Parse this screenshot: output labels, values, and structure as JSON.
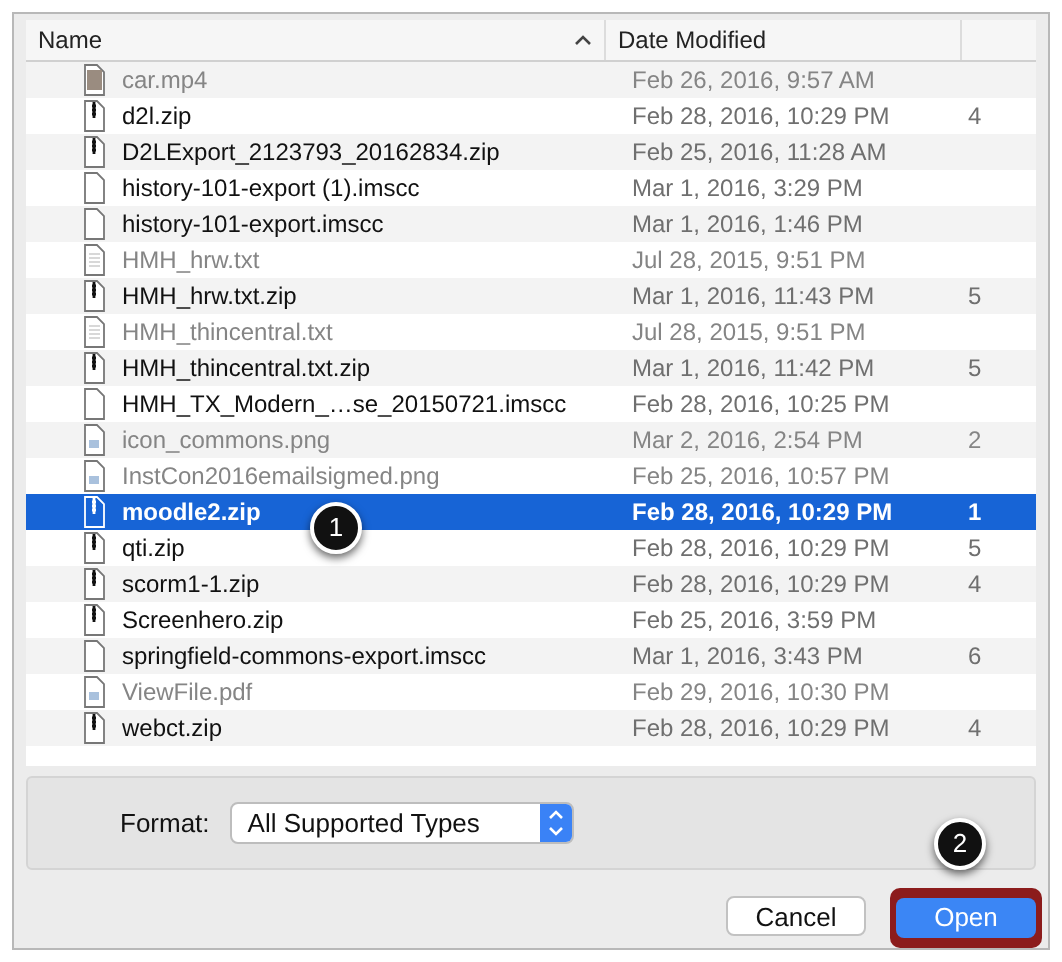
{
  "columns": [
    {
      "label": "Name",
      "sorted": true
    },
    {
      "label": "Date Modified",
      "sorted": false
    }
  ],
  "files": [
    {
      "name": "car.mp4",
      "date": "Feb 26, 2016, 9:57 AM",
      "kind": "video",
      "disabled": true,
      "selected": false
    },
    {
      "name": "d2l.zip",
      "date": "Feb 28, 2016, 10:29 PM",
      "size": "4",
      "kind": "zip",
      "disabled": false,
      "selected": false
    },
    {
      "name": "D2LExport_2123793_20162834.zip",
      "date": "Feb 25, 2016, 11:28 AM",
      "kind": "zip",
      "disabled": false,
      "selected": false
    },
    {
      "name": "history-101-export (1).imscc",
      "date": "Mar 1, 2016, 3:29 PM",
      "kind": "doc",
      "disabled": false,
      "selected": false
    },
    {
      "name": "history-101-export.imscc",
      "date": "Mar 1, 2016, 1:46 PM",
      "kind": "doc",
      "disabled": false,
      "selected": false
    },
    {
      "name": "HMH_hrw.txt",
      "date": "Jul 28, 2015, 9:51 PM",
      "kind": "text",
      "disabled": true,
      "selected": false
    },
    {
      "name": "HMH_hrw.txt.zip",
      "date": "Mar 1, 2016, 11:43 PM",
      "size": "5",
      "kind": "zip",
      "disabled": false,
      "selected": false
    },
    {
      "name": "HMH_thincentral.txt",
      "date": "Jul 28, 2015, 9:51 PM",
      "kind": "text",
      "disabled": true,
      "selected": false
    },
    {
      "name": "HMH_thincentral.txt.zip",
      "date": "Mar 1, 2016, 11:42 PM",
      "size": "5",
      "kind": "zip",
      "disabled": false,
      "selected": false
    },
    {
      "name": "HMH_TX_Modern_…se_20150721.imscc",
      "date": "Feb 28, 2016, 10:25 PM",
      "kind": "doc",
      "disabled": false,
      "selected": false
    },
    {
      "name": "icon_commons.png",
      "date": "Mar 2, 2016, 2:54 PM",
      "size": "2",
      "kind": "image",
      "disabled": true,
      "selected": false
    },
    {
      "name": "InstCon2016emailsigmed.png",
      "date": "Feb 25, 2016, 10:57 PM",
      "kind": "image",
      "disabled": true,
      "selected": false
    },
    {
      "name": "moodle2.zip",
      "date": "Feb 28, 2016, 10:29 PM",
      "size": "1",
      "kind": "zip",
      "disabled": false,
      "selected": true
    },
    {
      "name": "qti.zip",
      "date": "Feb 28, 2016, 10:29 PM",
      "size": "5",
      "kind": "zip",
      "disabled": false,
      "selected": false
    },
    {
      "name": "scorm1-1.zip",
      "date": "Feb 28, 2016, 10:29 PM",
      "size": "4",
      "kind": "zip",
      "disabled": false,
      "selected": false
    },
    {
      "name": "Screenhero.zip",
      "date": "Feb 25, 2016, 3:59 PM",
      "kind": "zip",
      "disabled": false,
      "selected": false
    },
    {
      "name": "springfield-commons-export.imscc",
      "date": "Mar 1, 2016, 3:43 PM",
      "size": "6",
      "kind": "doc",
      "disabled": false,
      "selected": false
    },
    {
      "name": "ViewFile.pdf",
      "date": "Feb 29, 2016, 10:30 PM",
      "kind": "image",
      "disabled": true,
      "selected": false
    },
    {
      "name": "webct.zip",
      "date": "Feb 28, 2016, 10:29 PM",
      "size": "4",
      "kind": "zip",
      "disabled": false,
      "selected": false
    }
  ],
  "format": {
    "label": "Format:",
    "value": "All Supported Types"
  },
  "buttons": [
    {
      "label": "Cancel",
      "default": false,
      "highlighted": false
    },
    {
      "label": "Open",
      "default": true,
      "highlighted": true
    }
  ],
  "callouts": [
    {
      "number": "1"
    },
    {
      "number": "2"
    }
  ]
}
